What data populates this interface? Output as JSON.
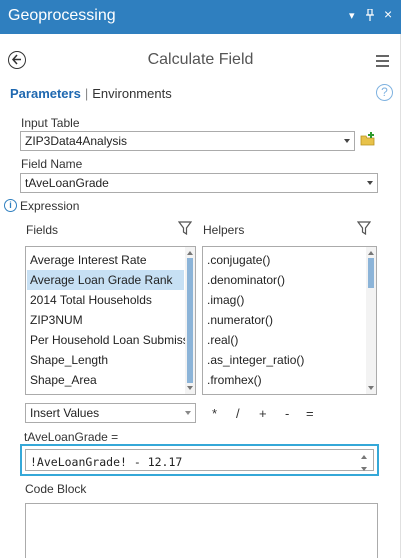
{
  "window": {
    "title": "Geoprocessing"
  },
  "header": {
    "title": "Calculate Field"
  },
  "tabs": {
    "parameters": "Parameters",
    "environments": "Environments"
  },
  "input_table": {
    "label": "Input Table",
    "value": "ZIP3Data4Analysis"
  },
  "field_name": {
    "label": "Field Name",
    "value": "tAveLoanGrade"
  },
  "expression": {
    "label": "Expression"
  },
  "fields": {
    "label": "Fields",
    "items": [
      "Average Interest Rate",
      "Average Loan Grade Rank",
      "2014 Total Households",
      "ZIP3NUM",
      "Per Household Loan Submiss",
      "Shape_Length",
      "Shape_Area"
    ],
    "selected_index": 1
  },
  "helpers": {
    "label": "Helpers",
    "items": [
      ".conjugate()",
      ".denominator()",
      ".imag()",
      ".numerator()",
      ".real()",
      ".as_integer_ratio()",
      ".fromhex()"
    ]
  },
  "insert_values": {
    "label": "Insert Values"
  },
  "operators": [
    "*",
    "/",
    "+",
    "-",
    "="
  ],
  "expr_target": {
    "label": "tAveLoanGrade ="
  },
  "expr_value": "!AveLoanGrade! - 12.17",
  "code_block": {
    "label": "Code Block",
    "value": ""
  },
  "colors": {
    "titlebar": "#2f7fbf",
    "accent": "#1f68b0",
    "highlight": "#c7e0f4",
    "focus": "#35a8d8"
  }
}
